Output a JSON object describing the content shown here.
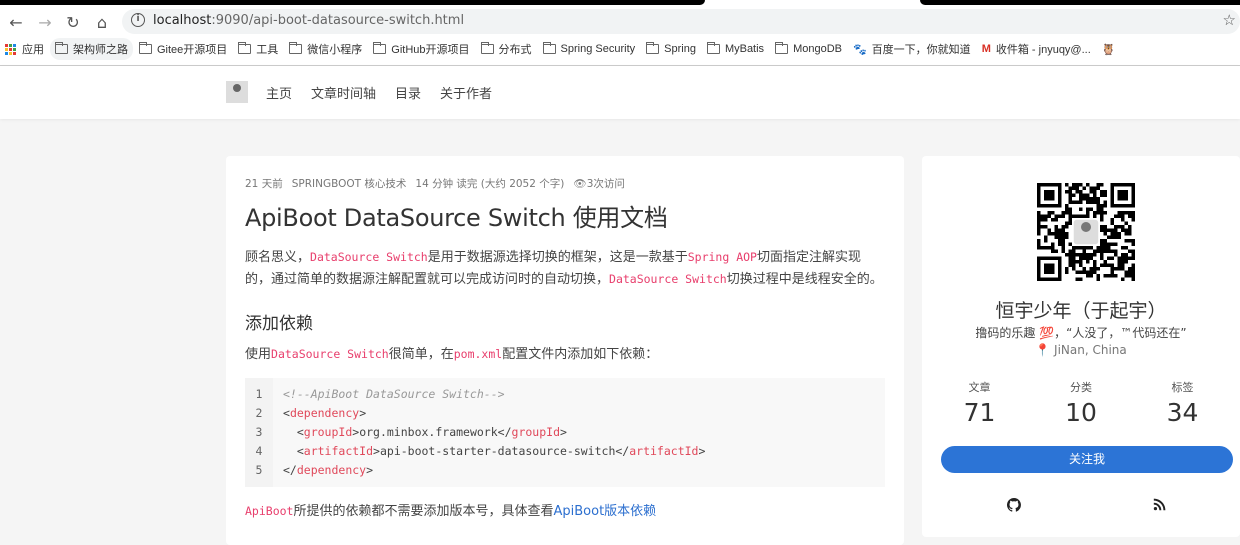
{
  "browser": {
    "url_host": "localhost",
    "url_rest": ":9090/api-boot-datasource-switch.html",
    "bookmarks": [
      "应用",
      "架构师之路",
      "Gitee开源项目",
      "工具",
      "微信小程序",
      "GitHub开源项目",
      "分布式",
      "Spring Security",
      "Spring",
      "MyBatis",
      "MongoDB",
      "百度一下，你就知道",
      "收件箱 - jnyuqy@..."
    ]
  },
  "nav": {
    "items": [
      "主页",
      "文章时间轴",
      "目录",
      "关于作者"
    ]
  },
  "article": {
    "meta": {
      "time": "21 天前",
      "category": "SPRINGBOOT 核心技术",
      "read": "14 分钟 读完 (大约 2052 个字)",
      "views": "3次访问"
    },
    "title": "ApiBoot DataSource Switch 使用文档",
    "intro": [
      "顾名思义，",
      "DataSource Switch",
      "是用于数据源选择切换的框架，这是一款基于",
      "Spring AOP",
      "切面指定注解实现的，通过简单的数据源注解配置就可以完成访问时的自动切换，",
      "DataSource Switch",
      "切换过程中是线程安全的。"
    ],
    "section": "添加依赖",
    "usage": [
      "使用",
      "DataSource Switch",
      "很简单，在",
      "pom.xml",
      "配置文件内添加如下依赖："
    ],
    "code": {
      "line_numbers": [
        "1",
        "2",
        "3",
        "4",
        "5"
      ],
      "comment": "<!--ApiBoot DataSource Switch-->",
      "dep_tag": "dependency",
      "group_tag": "groupId",
      "group_val": "org.minbox.framework",
      "artifact_tag": "artifactId",
      "artifact_val": "api-boot-starter-datasource-switch"
    },
    "note": [
      "ApiBoot",
      "所提供的依赖都不需要添加版本号，具体查看",
      "ApiBoot版本依赖"
    ]
  },
  "profile": {
    "name": "恒宇少年（于起宇）",
    "motto": "撸码的乐趣 💯，“人没了，™代码还在”",
    "location": "JiNan, China",
    "stats": [
      {
        "label": "文章",
        "value": "71"
      },
      {
        "label": "分类",
        "value": "10"
      },
      {
        "label": "标签",
        "value": "34"
      }
    ],
    "follow": "关注我"
  }
}
